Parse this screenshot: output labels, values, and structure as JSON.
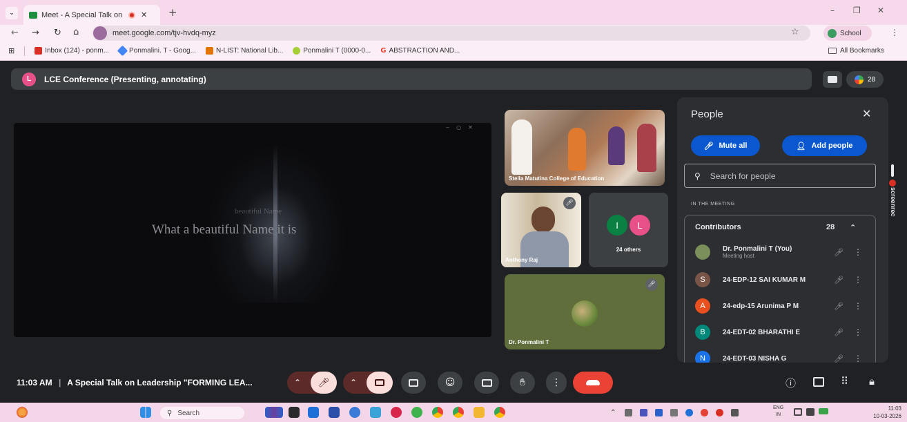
{
  "browser": {
    "tab_title": "Meet - A Special Talk on Le",
    "url": "meet.google.com/tjv-hvdq-myz",
    "profile_label": "School",
    "bookmarks": [
      "Inbox (124) - ponm...",
      "Ponmalini. T - Goog...",
      "N-LIST: National Lib...",
      "Ponmalini T (0000-0...",
      "ABSTRACTION AND..."
    ],
    "all_bookmarks_label": "All Bookmarks"
  },
  "meeting": {
    "banner_avatar": "L",
    "banner_text": "LCE Conference (Presenting, annotating)",
    "participant_count": "28",
    "slide_text": "What a beautiful Name it is",
    "slide_ghost_text": "beautiful Name",
    "tiles": {
      "room_label": "Stella Matutina College of Education",
      "speaker_label": "Anthony Raj",
      "others_avatars": [
        "I",
        "L"
      ],
      "others_label": "24 others",
      "self_label": "Dr. Ponmalini T"
    },
    "time": "11:03 AM",
    "title": "A Special Talk on Leadership \"FORMING LEA..."
  },
  "people_panel": {
    "title": "People",
    "mute_all_label": "Mute all",
    "add_people_label": "Add people",
    "search_placeholder": "Search for people",
    "section_label": "IN THE MEETING",
    "group_label": "Contributors",
    "group_count": "28",
    "participants": [
      {
        "avatar": "",
        "name": "Dr. Ponmalini T (You)",
        "role": "Meeting host",
        "color": "#7b8f5a"
      },
      {
        "avatar": "S",
        "name": "24-EDP-12 SAI KUMAR M",
        "role": "",
        "color": "#795548"
      },
      {
        "avatar": "A",
        "name": "24-edp-15 Arunima P M",
        "role": "",
        "color": "#e8501f"
      },
      {
        "avatar": "B",
        "name": "24-EDT-02 BHARATHI E",
        "role": "",
        "color": "#00897b"
      },
      {
        "avatar": "N",
        "name": "24-EDT-03 NISHA G",
        "role": "",
        "color": "#1a73e8"
      }
    ]
  },
  "screenrec_label": "screenrec",
  "taskbar": {
    "search_label": "Search",
    "lang_top": "ENG",
    "lang_bottom": "IN",
    "clock_time": "11:03",
    "clock_date": "10-03-2026"
  },
  "colors": {
    "meet_bg": "#202124",
    "primary_blue": "#0b57d0",
    "leave_red": "#ea4335",
    "muted_red": "#f9dedc",
    "chrome_pink": "#f6d9ea"
  }
}
